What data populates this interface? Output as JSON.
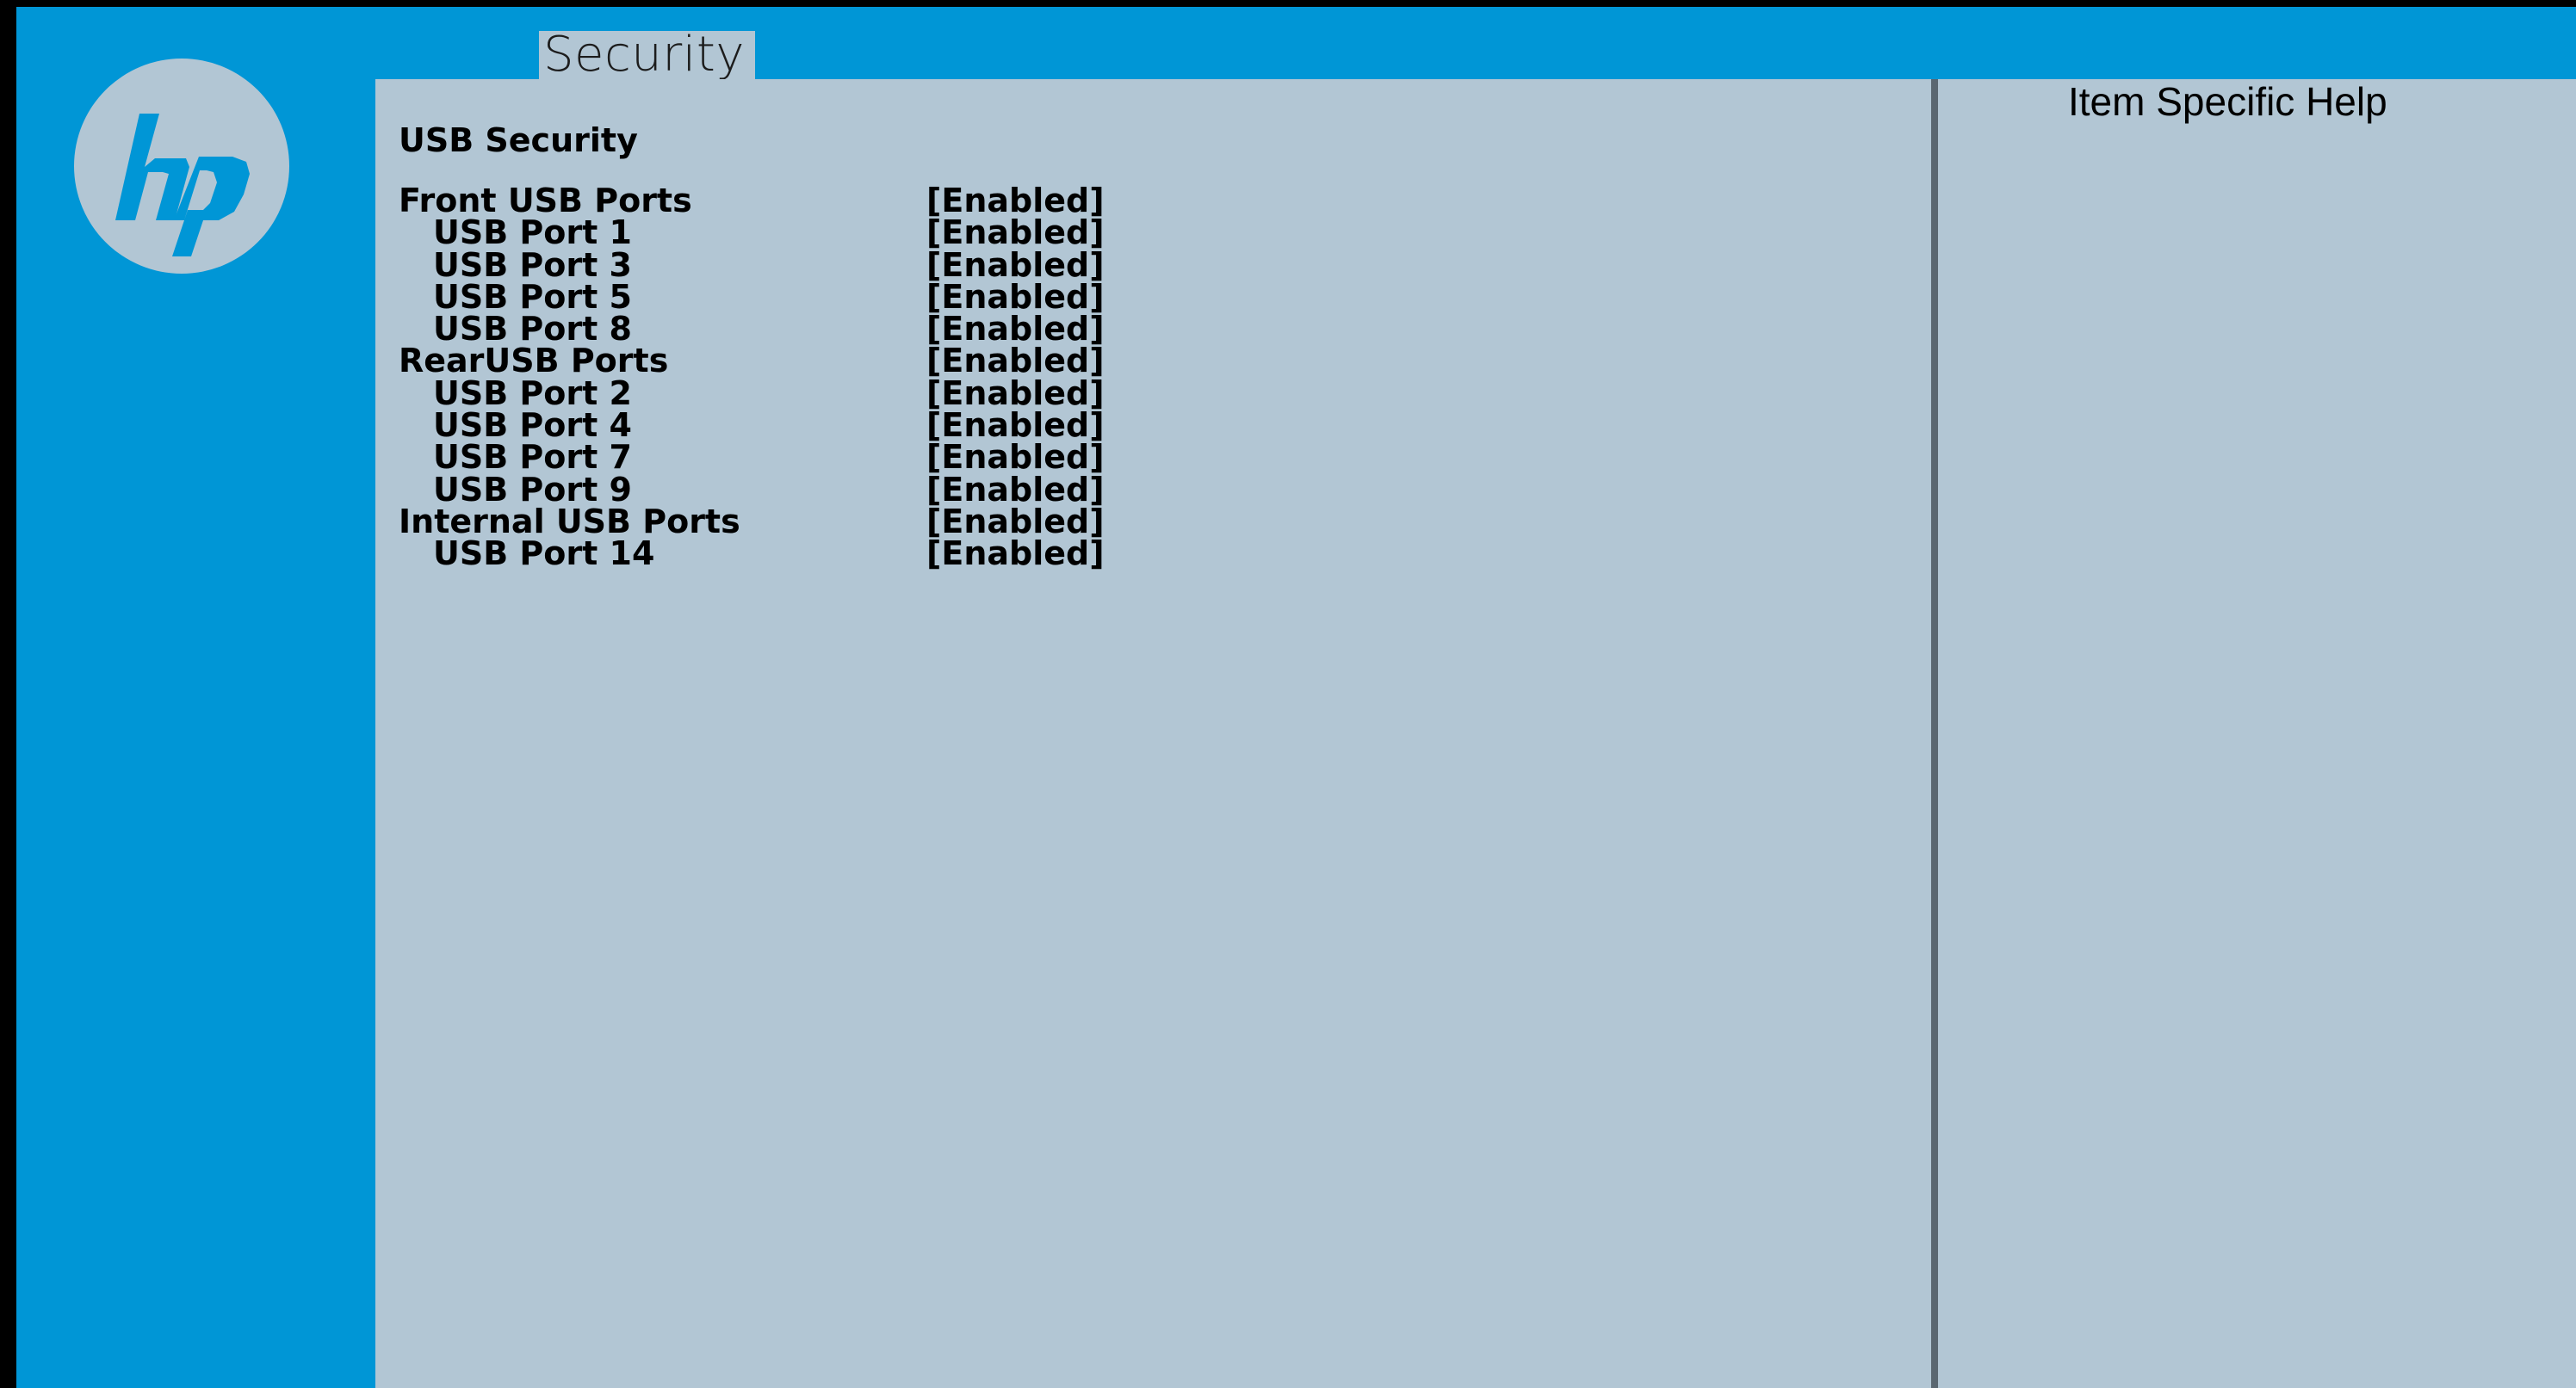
{
  "header": {
    "active_tab": "Security"
  },
  "logo": {
    "brand": "hp"
  },
  "main": {
    "section_title": "USB Security",
    "settings": [
      {
        "label": "Front USB Ports",
        "value": "[Enabled]",
        "level": "top"
      },
      {
        "label": "USB Port 1",
        "value": "[Enabled]",
        "level": "sub"
      },
      {
        "label": "USB Port 3",
        "value": "[Enabled]",
        "level": "sub"
      },
      {
        "label": "USB Port 5",
        "value": "[Enabled]",
        "level": "sub"
      },
      {
        "label": "USB Port 8",
        "value": "[Enabled]",
        "level": "sub"
      },
      {
        "label": "RearUSB Ports",
        "value": "[Enabled]",
        "level": "top"
      },
      {
        "label": "USB Port 2",
        "value": "[Enabled]",
        "level": "sub"
      },
      {
        "label": "USB Port 4",
        "value": "[Enabled]",
        "level": "sub"
      },
      {
        "label": "USB Port 7",
        "value": "[Enabled]",
        "level": "sub"
      },
      {
        "label": "USB Port 9",
        "value": "[Enabled]",
        "level": "sub"
      },
      {
        "label": "Internal USB Ports",
        "value": "[Enabled]",
        "level": "top"
      },
      {
        "label": "USB Port 14",
        "value": "[Enabled]",
        "level": "sub"
      }
    ]
  },
  "help_panel": {
    "title": "Item Specific Help"
  },
  "colors": {
    "frame_blue": "#0096d6",
    "panel": "#b2c6d4",
    "divider": "#5a6771",
    "text": "#000000"
  }
}
